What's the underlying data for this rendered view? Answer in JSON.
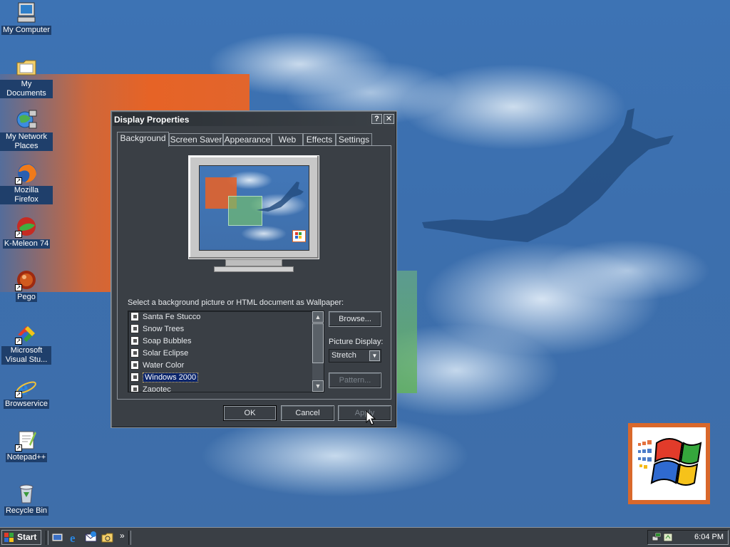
{
  "desktop": {
    "icons": [
      {
        "label": "My Computer",
        "icon": "computer-icon"
      },
      {
        "label": "My Documents",
        "icon": "folder-icon"
      },
      {
        "label": "My Network Places",
        "icon": "network-icon"
      },
      {
        "label": "Mozilla Firefox",
        "icon": "firefox-icon"
      },
      {
        "label": "K-Meleon 74",
        "icon": "kmeleon-icon"
      },
      {
        "label": "Pego",
        "icon": "pego-icon"
      },
      {
        "label": "Microsoft Visual Stu...",
        "icon": "visual-studio-icon"
      },
      {
        "label": "Browservice",
        "icon": "ie-icon"
      },
      {
        "label": "Notepad++",
        "icon": "notepadpp-icon"
      },
      {
        "label": "Recycle Bin",
        "icon": "recycle-bin-icon"
      }
    ]
  },
  "dialog": {
    "title": "Display Properties",
    "help_button": "?",
    "close_button": "✕",
    "tabs": [
      "Background",
      "Screen Saver",
      "Appearance",
      "Web",
      "Effects",
      "Settings"
    ],
    "active_tab": "Background",
    "prompt": "Select a background picture or HTML document as Wallpaper:",
    "wallpapers": [
      {
        "name": "Santa Fe Stucco",
        "selected": false
      },
      {
        "name": "Snow Trees",
        "selected": false
      },
      {
        "name": "Soap Bubbles",
        "selected": false
      },
      {
        "name": "Solar Eclipse",
        "selected": false
      },
      {
        "name": "Water Color",
        "selected": false
      },
      {
        "name": "Windows 2000",
        "selected": true
      },
      {
        "name": "Zapotec",
        "selected": false
      }
    ],
    "browse_label": "Browse...",
    "picture_display_label": "Picture Display:",
    "picture_display_value": "Stretch",
    "pattern_label": "Pattern...",
    "ok_label": "OK",
    "cancel_label": "Cancel",
    "apply_label": "Apply"
  },
  "taskbar": {
    "start_label": "Start",
    "quick_launch": [
      "show-desktop-icon",
      "ie-icon",
      "outlook-icon",
      "explorer-icon"
    ],
    "overflow": "»",
    "clock": "6:04 PM"
  },
  "colors": {
    "dialog_bg": "#3a3f45",
    "selection": "#0a246a",
    "wallpaper_blue": "#3d73b4",
    "wallpaper_orange": "#e66326"
  }
}
